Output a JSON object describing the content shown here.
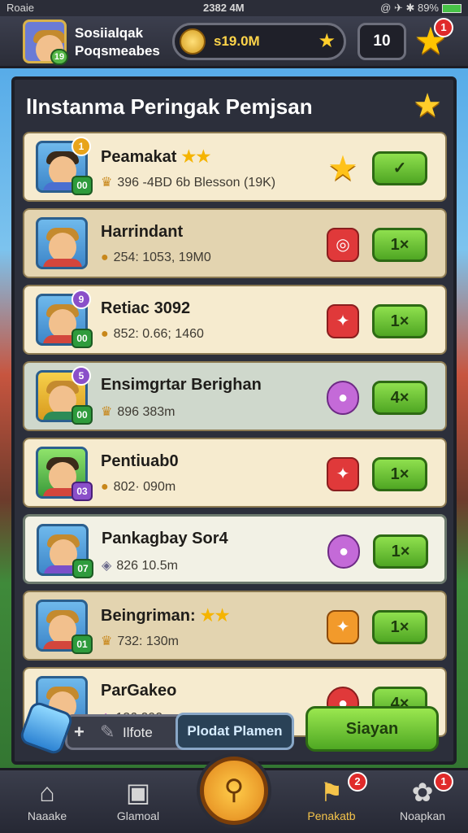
{
  "status_bar": {
    "left": "Roaie",
    "time": "2382 4M",
    "right": "@ ✈ ✱ 89%"
  },
  "header": {
    "app_name_line1": "Sosiialqak",
    "app_name_line2": "Poqsmeabes",
    "player_level": "19",
    "coins": "s19.0M",
    "counter": "10",
    "star_badge": "1"
  },
  "panel": {
    "title": "lInstanma Peringak Pemjsan"
  },
  "rows": [
    {
      "name": "Peamakat",
      "stars": "★★",
      "sub": "396 -4BD 6b Blesson (19K)",
      "level": "00",
      "rank": "1",
      "action": "✓"
    },
    {
      "name": "Harrindant",
      "stars": "",
      "sub": "254: 1053, 19M0",
      "level": "",
      "rank": "",
      "action": "1×"
    },
    {
      "name": "Retiac 3092",
      "stars": "",
      "sub": "852: 0.66; 1460",
      "level": "00",
      "rank": "9",
      "action": "1×"
    },
    {
      "name": "Ensimgrtar Berighan",
      "stars": "",
      "sub": "896  383m",
      "level": "00",
      "rank": "5",
      "action": "4×"
    },
    {
      "name": "Pentiuab0",
      "stars": "",
      "sub": "802· 090m",
      "level": "03",
      "rank": "",
      "action": "1×"
    },
    {
      "name": "Pankagbay Sor4",
      "stars": "",
      "sub": "826 10.5m",
      "level": "07",
      "rank": "",
      "action": "1×"
    },
    {
      "name": "Beingriman:",
      "stars": "★★",
      "sub": "732: 130m",
      "level": "01",
      "rank": "",
      "action": "1×"
    },
    {
      "name": "ParGakeo",
      "stars": "",
      "sub": "126 090m",
      "level": "",
      "rank": "",
      "action": "4×"
    }
  ],
  "tools": {
    "tool_label": "Ilfote",
    "tool_b_label": "Plodat Plamen",
    "primary_button": "Siayan"
  },
  "nav": {
    "items": [
      {
        "label": "Naaake",
        "badge": ""
      },
      {
        "label": "Glamoal",
        "badge": ""
      },
      {
        "label": "Penakatb",
        "badge": "2"
      },
      {
        "label": "Noapkan",
        "badge": "1"
      }
    ]
  },
  "colors": {
    "accent_green": "#4fa623",
    "gold": "#ffcf2c",
    "panel": "#2c2f3b"
  }
}
